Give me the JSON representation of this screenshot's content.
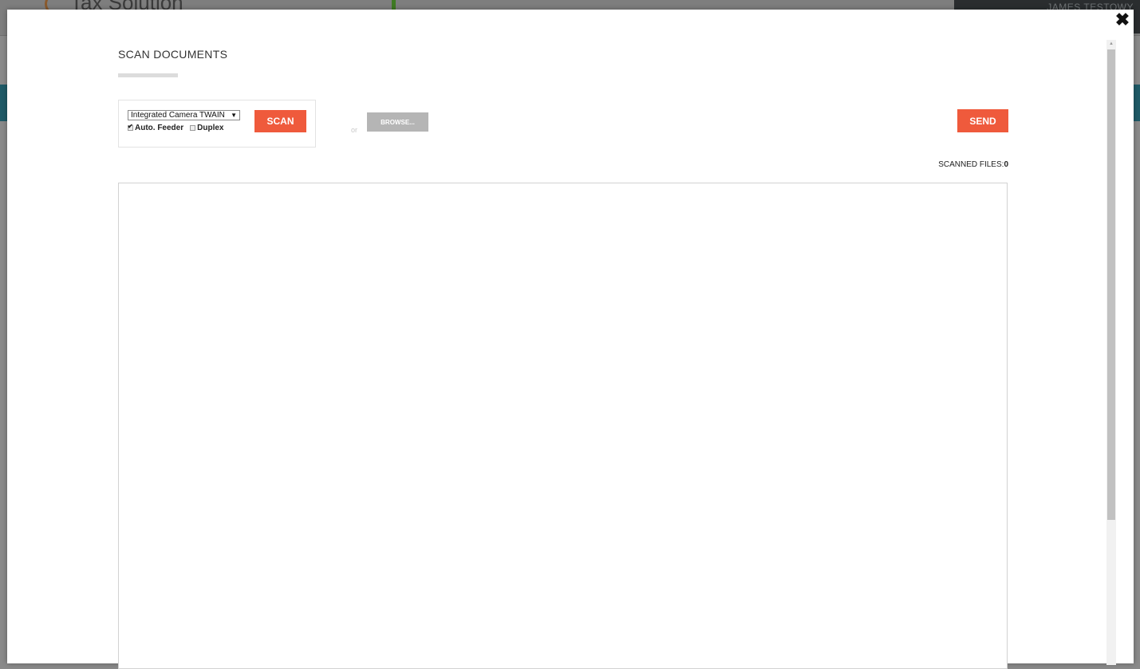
{
  "background_app": {
    "logo_text": "Tax Solution",
    "user_name": "JAMES TESTOWY"
  },
  "modal": {
    "title": "SCAN DOCUMENTS",
    "close_icon": "close-icon",
    "scanner": {
      "selected_source": "Integrated Camera TWAIN",
      "dropdown_arrow": "▼",
      "auto_feeder_label": "Auto. Feeder",
      "auto_feeder_checked": true,
      "duplex_label": "Duplex",
      "duplex_checked": false,
      "scan_label": "SCAN"
    },
    "or_label": "or",
    "browse_label": "BROWSE...",
    "send_label": "SEND",
    "scanned_files_label": "SCANNED FILES:",
    "scanned_files_count": "0"
  },
  "colors": {
    "accent": "#ef5a3c",
    "browse_button": "#b5b5b5",
    "overlay": "#8a8a8a"
  }
}
